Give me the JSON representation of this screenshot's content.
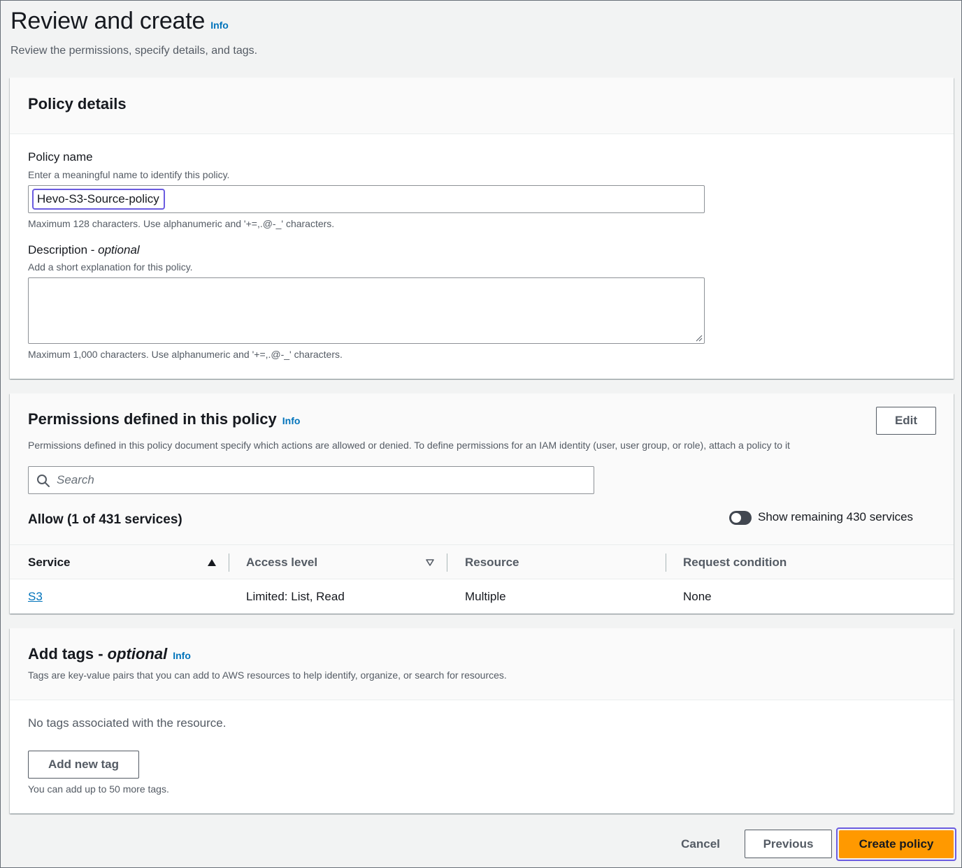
{
  "header": {
    "title": "Review and create",
    "info": "Info",
    "subtitle": "Review the permissions, specify details, and tags."
  },
  "policy_details": {
    "title": "Policy details",
    "name_label": "Policy name",
    "name_desc": "Enter a meaningful name to identify this policy.",
    "name_value": "Hevo-S3-Source-policy",
    "name_constraint": "Maximum 128 characters. Use alphanumeric and '+=,.@-_' characters.",
    "description_label": "Description - ",
    "description_optional": "optional",
    "description_desc": "Add a short explanation for this policy.",
    "description_value": "",
    "description_constraint": "Maximum 1,000 characters. Use alphanumeric and '+=,.@-_' characters."
  },
  "permissions": {
    "title": "Permissions defined in this policy",
    "info": "Info",
    "edit_label": "Edit",
    "description": "Permissions defined in this policy document specify which actions are allowed or denied. To define permissions for an IAM identity (user, user group, or role), attach a policy to it",
    "search_placeholder": "Search",
    "allow_title": "Allow (1 of 431 services)",
    "toggle_label": "Show remaining 430 services",
    "toggle_on": false,
    "columns": [
      "Service",
      "Access level",
      "Resource",
      "Request condition"
    ],
    "rows": [
      {
        "service": "S3",
        "access_level": "Limited: List, Read",
        "resource": "Multiple",
        "request_condition": "None"
      }
    ]
  },
  "tags": {
    "title": "Add tags - ",
    "title_optional": "optional",
    "info": "Info",
    "description": "Tags are key-value pairs that you can add to AWS resources to help identify, organize, or search for resources.",
    "empty_text": "No tags associated with the resource.",
    "add_label": "Add new tag",
    "limit_text": "You can add up to 50 more tags."
  },
  "footer": {
    "cancel": "Cancel",
    "previous": "Previous",
    "create": "Create policy"
  },
  "colors": {
    "accent_link": "#0073bb",
    "primary_button": "#ff9900",
    "focus_ring": "#6b5ce0",
    "page_bg": "#f2f3f3"
  }
}
